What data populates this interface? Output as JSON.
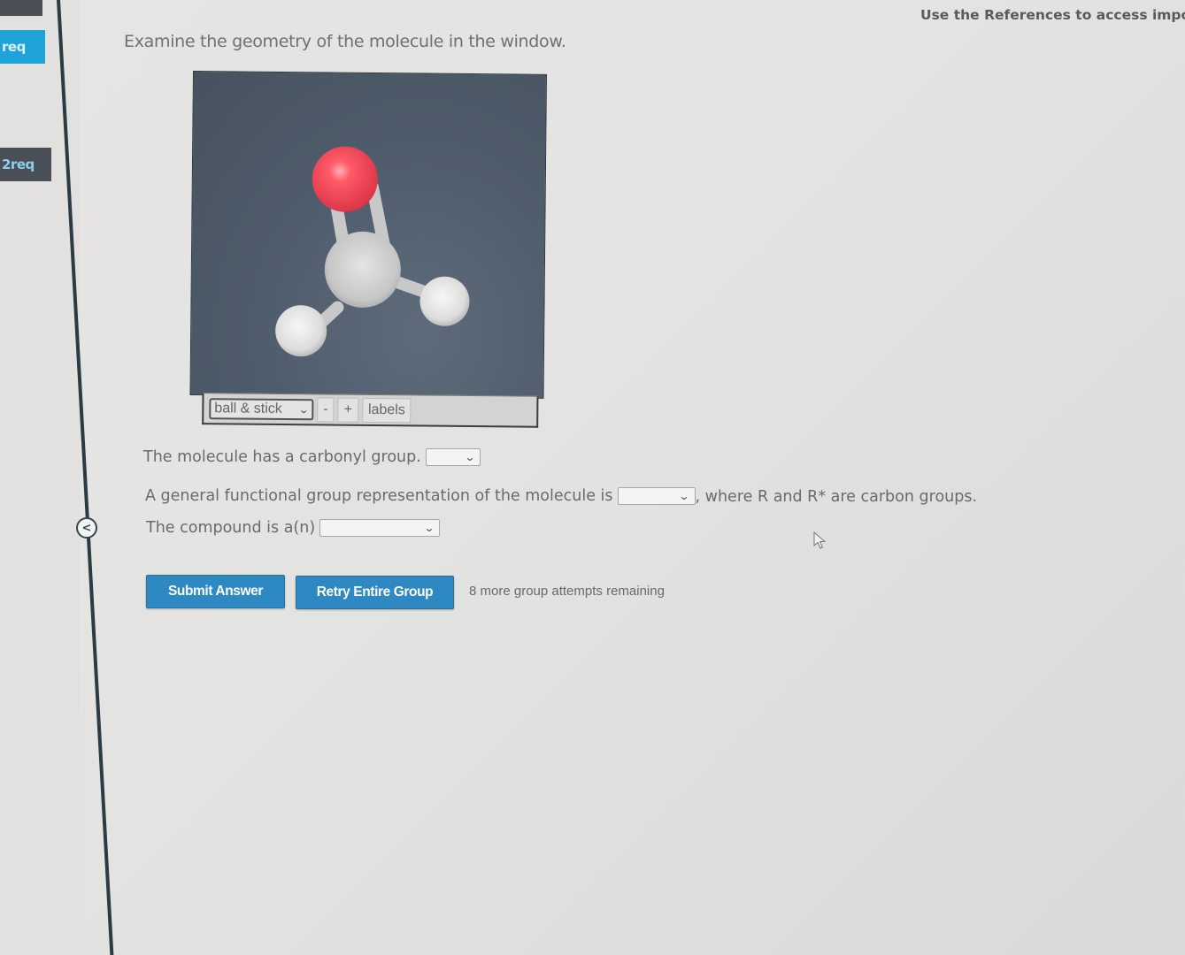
{
  "sidebar": {
    "tabs": [
      {
        "label": "req",
        "active": true
      },
      {
        "label": "2req",
        "active": false
      }
    ],
    "collapse_icon": "chevron-left-icon",
    "collapse_glyph": "<"
  },
  "header": {
    "references_text": "Use the References to access importar"
  },
  "question": {
    "instructions": "Examine the geometry of the molecule in the window.",
    "viewer": {
      "render_mode": "ball & stick",
      "zoom_out_label": "-",
      "zoom_in_label": "+",
      "labels_label": "labels",
      "atoms": [
        {
          "element": "O",
          "color": "#f04a5a"
        },
        {
          "element": "C",
          "color": "#c9c9c9"
        },
        {
          "element": "H",
          "color": "#e6e6e6"
        },
        {
          "element": "H",
          "color": "#e6e6e6"
        }
      ]
    },
    "prompts": [
      {
        "text": "The molecule has a carbonyl group.",
        "selected": ""
      },
      {
        "text": "A general functional group representation of the molecule is",
        "selected": "",
        "suffix": ", where R and R* are carbon groups."
      },
      {
        "text": "The compound is a(n)",
        "selected": ""
      }
    ]
  },
  "actions": {
    "submit_label": "Submit Answer",
    "retry_label": "Retry Entire Group",
    "attempts_text": "8 more group attempts remaining"
  },
  "colors": {
    "button_primary": "#2e88c2",
    "active_tab": "#1ea3d8",
    "inactive_tab": "#4a4f58",
    "viewer_background": "#4f5c6b"
  }
}
